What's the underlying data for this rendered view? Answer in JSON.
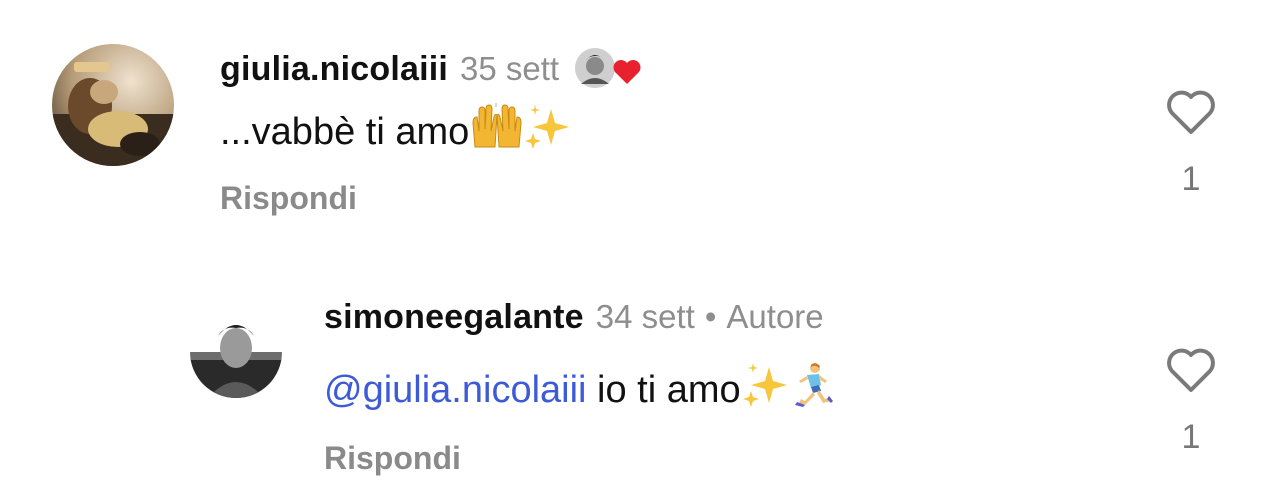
{
  "comments": [
    {
      "username": "giulia.nicolaiii",
      "time": "35 sett",
      "text": "...vabbè ti amo",
      "text_emojis": [
        "raising-hands-emoji",
        "sparkles-emoji"
      ],
      "reply_label": "Rispondi",
      "like_count": "1",
      "liked_by_author": true
    },
    {
      "username": "simoneegalante",
      "time": "34 sett",
      "separator": "•",
      "author_label": "Autore",
      "mention": "@giulia.nicolaiii",
      "text": " io ti amo",
      "text_emojis": [
        "sparkles-emoji",
        "running-man-emoji"
      ],
      "reply_label": "Rispondi",
      "like_count": "1"
    }
  ],
  "colors": {
    "mention": "#3d5bd6",
    "muted": "#8e8e8e",
    "heart_red": "#e8212e"
  }
}
